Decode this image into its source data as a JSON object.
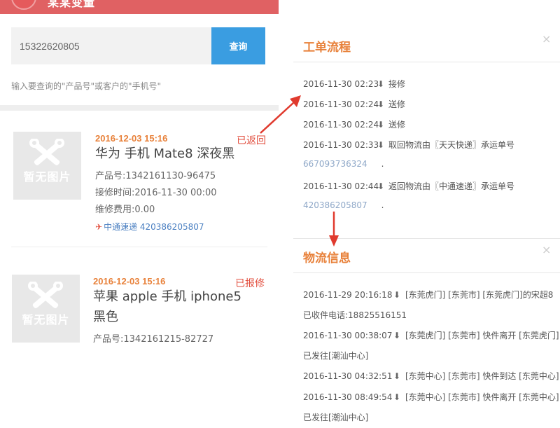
{
  "header": {
    "title": "某某变量"
  },
  "search": {
    "value": "15322620805",
    "button_label": "查询",
    "hint": "输入要查询的\"产品号\"或客户的\"手机号\""
  },
  "orders": [
    {
      "thumb_text": "暂无图片",
      "date": "2016-12-03 15:16",
      "status": "已返回",
      "name": "华为 手机 Mate8 深夜黑",
      "product_no": "产品号:1342161130-96475",
      "receive_time": "接修时间:2016-11-30 00:00",
      "fee": "维修费用:0.00",
      "tracking": "中通速递 420386205807"
    },
    {
      "thumb_text": "暂无图片",
      "date": "2016-12-03 15:16",
      "status": "已报修",
      "name_line1": "苹果 apple 手机 iphone5",
      "name_line2": "黑色",
      "product_no": "产品号:1342161215-82727"
    }
  ],
  "workflow": {
    "title": "工单流程",
    "close": "×",
    "rows": [
      {
        "time": "2016-11-30 02:23",
        "text": "接修"
      },
      {
        "time": "2016-11-30 02:24",
        "text": "送修"
      },
      {
        "time": "2016-11-30 02:24",
        "text": "送修"
      },
      {
        "time": "2016-11-30 02:33",
        "text": "取回物流由〖天天快递〗承运单号",
        "link": "667093736324",
        "dot": "."
      },
      {
        "time": "2016-11-30 02:44",
        "text": "返回物流由〖中通速递〗承运单号",
        "link": "420386205807",
        "dot": "."
      }
    ]
  },
  "logistics": {
    "title": "物流信息",
    "close": "×",
    "rows": [
      {
        "time": "2016-11-29 20:16:18",
        "text": "[东莞虎门] [东莞市] [东莞虎门]的宋超8",
        "cont": "已收件电话:18825516151"
      },
      {
        "time": "2016-11-30 00:38:07",
        "text": "[东莞虎门] [东莞市] 快件离开 [东莞虎门]",
        "cont": "已发往[潮汕中心]"
      },
      {
        "time": "2016-11-30 04:32:51",
        "text": "[东莞中心] [东莞市] 快件到达 [东莞中心]",
        "cont": ""
      },
      {
        "time": "2016-11-30 08:49:54",
        "text": "[东莞中心] [东莞市] 快件离开 [东莞中心]",
        "cont": "已发往[潮汕中心]"
      }
    ]
  },
  "icons": {
    "arrow_down": "down-arrow-icon",
    "plane": "plane-icon",
    "menu": "hamburger-icon"
  },
  "colors": {
    "accent_orange": "#e8813a",
    "status_red": "#e24e3e",
    "button_blue": "#3a9de1",
    "header_red": "#e06163"
  }
}
